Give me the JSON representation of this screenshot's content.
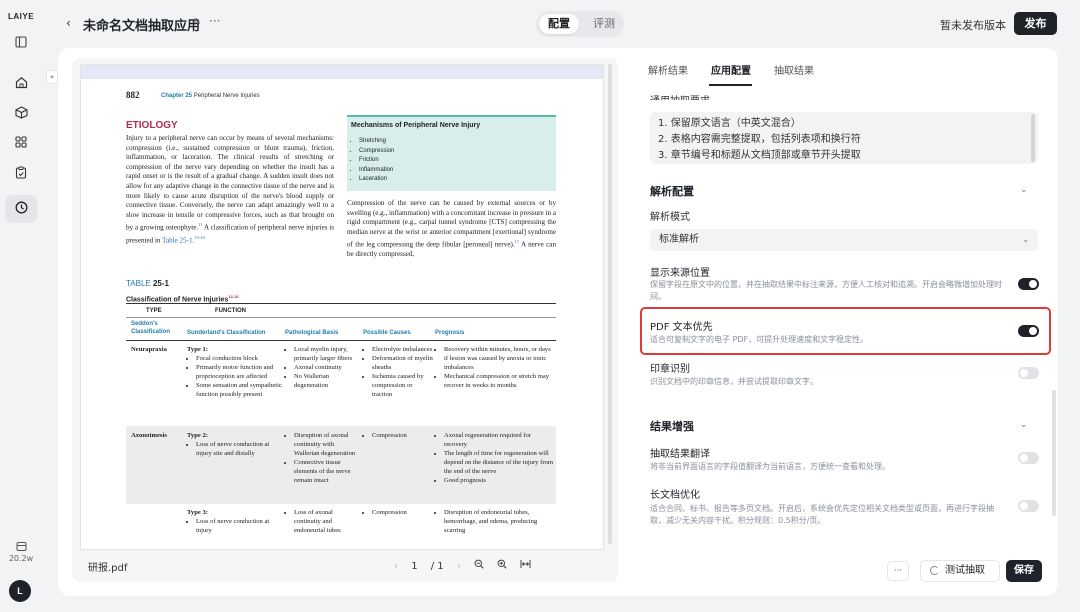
{
  "rail": {
    "logo": "LAIYE",
    "credit": "20.2w",
    "avatar": "L"
  },
  "header": {
    "app_title": "未命名文档抽取应用",
    "seg_tabs": [
      "配置",
      "评测"
    ],
    "version_status": "暂未发布版本",
    "publish_label": "发布"
  },
  "pdf": {
    "page_number": "882",
    "chapter_label": "Chapter 25",
    "chapter_title": "Peripheral Nerve Injuries",
    "heading": "ETIOLOGY",
    "left_para_a": "Injury to a peripheral nerve can occur by means of several mechanisms: compression (i.e., sustained compression or blunt trauma), friction, inflammation, or laceration. The clinical results of stretching or compression of the nerve vary depending on whether the insult has a rapid onset or is the result of a gradual change. A sudden insult does not allow for any adaptive change in the connective tissue of the nerve and is more likely to cause acute disruption of the nerve's blood supply or connective tissue. Conversely, the nerve can adapt amazingly well to a slow increase in tensile or compressive forces, such as that brought on by a growing osteophyte.",
    "left_sup_a": "11",
    "left_para_b": " A classification of peripheral nerve injuries is presented in ",
    "left_ref": "Table 25-1.",
    "left_sup_b": "13-16",
    "box_title": "Mechanisms of Peripheral Nerve Injury",
    "box_items": [
      "Stretching",
      "Compression",
      "Friction",
      "Inflammation",
      "Laceration"
    ],
    "right_para": "Compression of the nerve can be caused by external sources or by swelling (e.g., inflammation) with a concomitant increase in pressure in a rigid compartment (e.g., carpal tunnel syndrome [CTS] compressing the median nerve at the wrist or anterior compartment [exertional] syndrome of the leg compressing the deep fibular [peroneal] nerve).",
    "right_sup": "17",
    "right_para_tail": " A nerve can be directly compressed,",
    "table_label": "TABLE",
    "table_num": "25-1",
    "table_caption": "Classification of Nerve Injuries",
    "table_caption_sup": "13-16",
    "col_type": "TYPE",
    "col_function": "FUNCTION",
    "sub_seddon": "Seddon's Classification",
    "sub_sunderland": "Sunderland's Classification",
    "sub_patho": "Pathological Basis",
    "sub_causes": "Possible Causes",
    "sub_prognosis": "Prognosis",
    "rows": [
      {
        "seddon": "Neurapraxia",
        "type": "Type 1:",
        "type_items": [
          "Focal conduction block",
          "Primarily motor function and proprioception are affected",
          "Some sensation and sympathetic function possibly present"
        ],
        "patho": [
          "Local myelin injury, primarily larger fibers",
          "Axonal continuity",
          "No Wallerian degeneration"
        ],
        "causes": [
          "Electrolyte imbalances",
          "Deformation of myelin sheaths",
          "Ischemia caused by compression or traction"
        ],
        "prognosis": [
          "Recovery within minutes, hours, or days if lesion was caused by anoxia or ionic imbalances",
          "Mechanical compression or stretch may recover in weeks to months"
        ]
      },
      {
        "seddon": "Axonotmesis",
        "type": "Type 2:",
        "type_items": [
          "Loss of nerve conduction at injury site and distally"
        ],
        "patho": [
          "Disruption of axonal continuity with Wallerian degeneration",
          "Connective tissue elements of the nerve remain intact"
        ],
        "causes": [
          "Compression"
        ],
        "prognosis": [
          "Axonal regeneration required for recovery",
          "The length of time for regeneration will depend on the distance of the injury from the end of the nerve",
          "Good prognosis"
        ]
      },
      {
        "seddon": "",
        "type": "Type 3:",
        "type_items": [
          "Loss of nerve conduction at injury"
        ],
        "patho": [
          "Loss of axonal continuity and endoneurial tubes"
        ],
        "causes": [
          "Compression"
        ],
        "prognosis": [
          "Disruption of endoneurial tubes, hemorrhage, and edema, producing scarring"
        ]
      }
    ],
    "file_name": "研报.pdf",
    "current_page": "1",
    "total_pages": "/ 1"
  },
  "panel": {
    "tabs": [
      "解析结果",
      "应用配置",
      "抽取结果"
    ],
    "cut_label": "通用抽取要求",
    "rules": [
      "1. 保留原文语言（中英文混合）",
      "2. 表格内容需完整提取，包括列表项和换行符",
      "3. 章节编号和标题从文档顶部或章节开头提取"
    ],
    "parse_section": "解析配置",
    "parse_mode_label": "解析模式",
    "parse_mode_value": "标准解析",
    "options": [
      {
        "title": "显示来源位置",
        "desc": "保留字段在原文中的位置，并在抽取结果中标注来源，方便人工核对和追溯。开启会略微增加处理时间。",
        "on": true
      },
      {
        "title": "PDF 文本优先",
        "desc": "适合可复制文字的电子 PDF，可提升处理速度和文字稳定性。",
        "on": true
      },
      {
        "title": "印章识别",
        "desc": "识别文档中的印章信息，并尝试提取印章文字。",
        "on": false
      }
    ],
    "enhance_section": "结果增强",
    "enhance_options": [
      {
        "title": "抽取结果翻译",
        "desc": "将非当前界面语言的字段值翻译为当前语言，方便统一查看和处理。",
        "on": false
      },
      {
        "title": "长文档优化",
        "desc": "适合合同、标书、报告等多页文档。开启后，系统会优先定位相关文档类型或页面，再进行字段抽取，减少无关内容干扰。积分规则：0.5积分/页。",
        "on": false
      }
    ],
    "more_label": "···",
    "test_label": "测试抽取",
    "save_label": "保存"
  }
}
